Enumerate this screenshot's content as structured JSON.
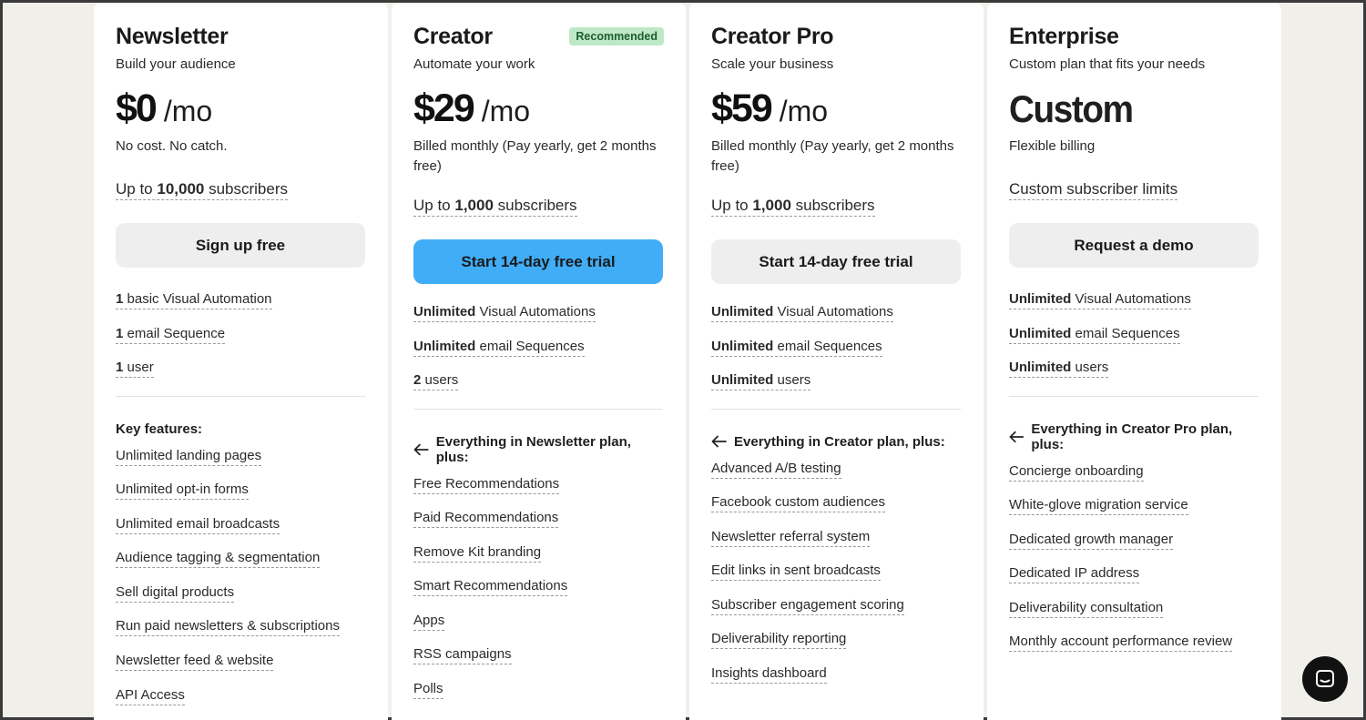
{
  "plans": [
    {
      "name": "Newsletter",
      "tagline": "Build your audience",
      "price": "$0",
      "per": "/mo",
      "billing": "No cost. No catch.",
      "subs_prefix": "Up to ",
      "subs_count": "10,000",
      "subs_suffix": " subscribers",
      "cta": "Sign up free",
      "limits": [
        {
          "bold": "1",
          "text": " basic Visual Automation"
        },
        {
          "bold": "1",
          "text": " email Sequence"
        },
        {
          "bold": "1",
          "text": " user"
        }
      ],
      "features_heading": "Key features:",
      "features": [
        "Unlimited landing pages",
        "Unlimited opt-in forms",
        "Unlimited email broadcasts",
        "Audience tagging & segmentation",
        "Sell digital products",
        "Run paid newsletters & subscriptions",
        "Newsletter feed & website",
        "API Access"
      ]
    },
    {
      "name": "Creator",
      "badge": "Recommended",
      "tagline": "Automate your work",
      "price": "$29",
      "per": "/mo",
      "billing": "Billed monthly (Pay yearly, get 2 months free)",
      "subs_prefix": "Up to ",
      "subs_count": "1,000",
      "subs_suffix": " subscribers",
      "cta": "Start 14-day free trial",
      "limits": [
        {
          "bold": "Unlimited",
          "text": " Visual Automations"
        },
        {
          "bold": "Unlimited",
          "text": " email Sequences"
        },
        {
          "bold": "2",
          "text": " users"
        }
      ],
      "features_heading": "Everything in Newsletter plan, plus:",
      "features": [
        "Free Recommendations",
        "Paid Recommendations",
        "Remove Kit branding",
        "Smart Recommendations",
        "Apps",
        "RSS campaigns",
        "Polls"
      ]
    },
    {
      "name": "Creator Pro",
      "tagline": "Scale your business",
      "price": "$59",
      "per": "/mo",
      "billing": "Billed monthly (Pay yearly, get 2 months free)",
      "subs_prefix": "Up to ",
      "subs_count": "1,000",
      "subs_suffix": " subscribers",
      "cta": "Start 14-day free trial",
      "limits": [
        {
          "bold": "Unlimited",
          "text": " Visual Automations"
        },
        {
          "bold": "Unlimited",
          "text": " email Sequences"
        },
        {
          "bold": "Unlimited",
          "text": " users"
        }
      ],
      "features_heading": "Everything in Creator plan, plus:",
      "features": [
        "Advanced A/B testing",
        "Facebook custom audiences",
        "Newsletter referral system",
        "Edit links in sent broadcasts",
        "Subscriber engagement scoring",
        "Deliverability reporting",
        "Insights dashboard"
      ]
    },
    {
      "name": "Enterprise",
      "tagline": "Custom plan that fits your needs",
      "price": "Custom",
      "billing": "Flexible billing",
      "subs_text": "Custom subscriber limits",
      "cta": "Request a demo",
      "limits": [
        {
          "bold": "Unlimited",
          "text": " Visual Automations"
        },
        {
          "bold": "Unlimited",
          "text": " email Sequences"
        },
        {
          "bold": "Unlimited",
          "text": " users"
        }
      ],
      "features_heading": "Everything in Creator Pro plan, plus:",
      "features": [
        "Concierge onboarding",
        "White-glove migration service",
        "Dedicated growth manager",
        "Dedicated IP address",
        "Deliverability consultation",
        "Monthly account performance review"
      ]
    }
  ],
  "colors": {
    "primary_cta": "#41adf7",
    "badge_bg": "#bfe8c6",
    "badge_text": "#1d5d2b",
    "page_bg": "#f1efea"
  },
  "chat": {
    "icon": "chat-icon"
  }
}
